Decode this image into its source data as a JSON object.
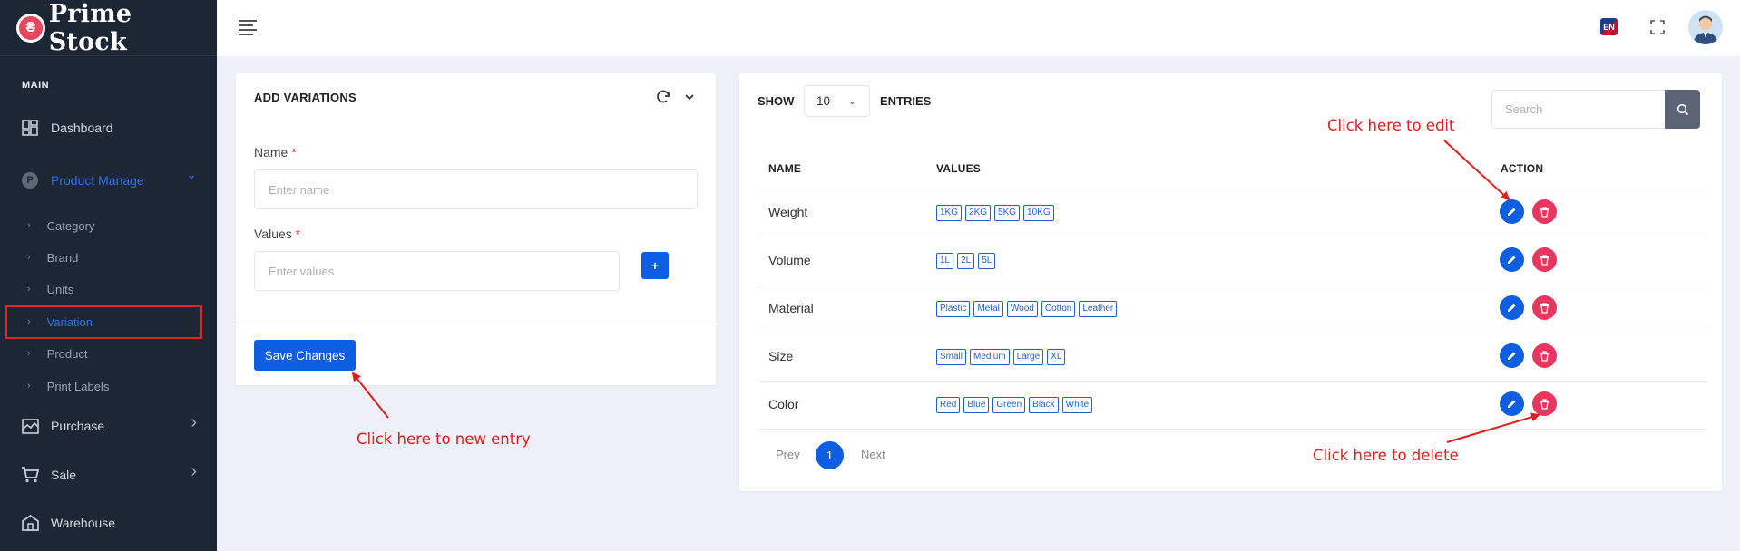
{
  "app": {
    "logo_glyph": "₴",
    "title": "Prime Stock"
  },
  "sidebar": {
    "section": "MAIN",
    "items": [
      {
        "label": "Dashboard",
        "icon": "dashboard-icon"
      },
      {
        "label": "Product Manage",
        "icon": "product-icon",
        "expanded": true
      },
      {
        "label": "Purchase",
        "icon": "purchase-icon"
      },
      {
        "label": "Sale",
        "icon": "cart-icon"
      },
      {
        "label": "Warehouse",
        "icon": "warehouse-icon"
      }
    ],
    "subitems": [
      {
        "label": "Category"
      },
      {
        "label": "Brand"
      },
      {
        "label": "Units"
      },
      {
        "label": "Variation",
        "active": true
      },
      {
        "label": "Product"
      },
      {
        "label": "Print Labels"
      }
    ],
    "sub_bullet": "›",
    "chevron_right": "›",
    "chevron_down": "⌄",
    "product_letter": "P"
  },
  "header": {
    "language": "EN"
  },
  "form": {
    "title": "ADD VARIATIONS",
    "name_label": "Name",
    "name_placeholder": "Enter name",
    "values_label": "Values",
    "values_placeholder": "Enter values",
    "required_mark": "*",
    "add_button": "+",
    "save_button": "Save Changes"
  },
  "table": {
    "show_label": "SHOW",
    "entries_label": "ENTRIES",
    "page_size": "10",
    "caret": "⌄",
    "search_placeholder": "Search",
    "headers": {
      "name": "NAME",
      "values": "VALUES",
      "action": "ACTION"
    },
    "rows": [
      {
        "name": "Weight",
        "values": [
          "1KG",
          "2KG",
          "5KG",
          "10KG"
        ]
      },
      {
        "name": "Volume",
        "values": [
          "1L",
          "2L",
          "5L"
        ]
      },
      {
        "name": "Material",
        "values": [
          "Plastic",
          "Metal",
          "Wood",
          "Cotton",
          "Leather"
        ]
      },
      {
        "name": "Size",
        "values": [
          "Small",
          "Medium",
          "Large",
          "XL"
        ]
      },
      {
        "name": "Color",
        "values": [
          "Red",
          "Blue",
          "Green",
          "Black",
          "White"
        ]
      }
    ],
    "pagination": {
      "prev": "Prev",
      "current": "1",
      "next": "Next"
    }
  },
  "annotations": {
    "edit": "Click here to edit",
    "new_entry": "Click here to new entry",
    "delete": "Click here to delete"
  },
  "colors": {
    "sidebar_bg": "#1d2634",
    "primary": "#0d5ee0",
    "danger": "#e8365e",
    "annotation": "#e31d1d",
    "background": "#eef0f7"
  }
}
